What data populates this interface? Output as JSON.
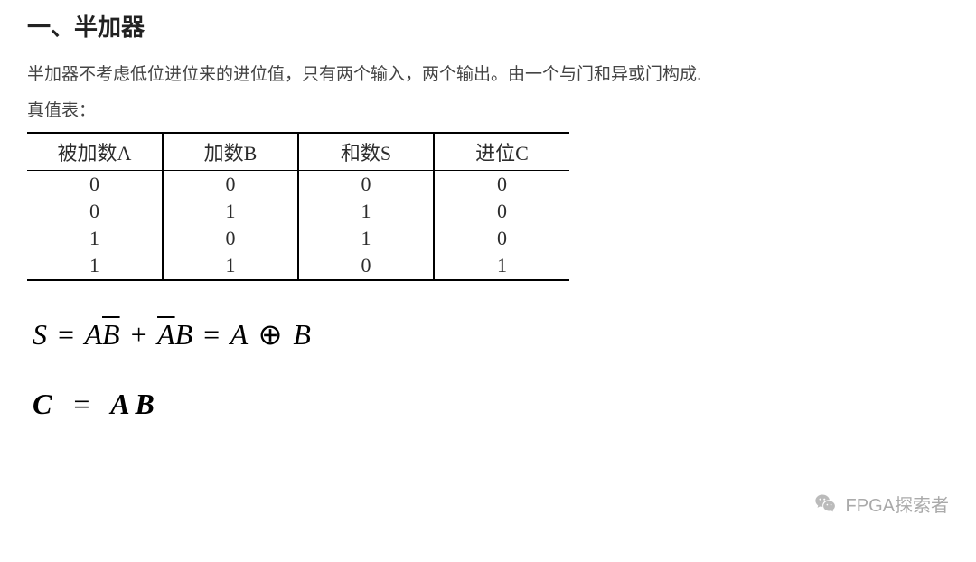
{
  "section_title": "一、半加器",
  "description": "半加器不考虑低位进位来的进位值，只有两个输入，两个输出。由一个与门和异或门构成.",
  "truth_table_label": "真值表：",
  "chart_data": {
    "type": "table",
    "headers": [
      "被加数A",
      "加数B",
      "和数S",
      "进位C"
    ],
    "rows": [
      [
        "0",
        "0",
        "0",
        "0"
      ],
      [
        "0",
        "1",
        "1",
        "0"
      ],
      [
        "1",
        "0",
        "1",
        "0"
      ],
      [
        "1",
        "1",
        "0",
        "1"
      ]
    ]
  },
  "formula_s": {
    "lhs": "S",
    "eq1": "=",
    "term1a": "A",
    "term1b_bar": "B",
    "plus": "+",
    "term2a_bar": "A",
    "term2b": "B",
    "eq2": "=",
    "term3a": "A",
    "xor": "⊕",
    "term3b": "B"
  },
  "formula_c": {
    "lhs": "C",
    "eq": "=",
    "rhs": "AB"
  },
  "watermark": {
    "text": "FPGA探索者"
  }
}
